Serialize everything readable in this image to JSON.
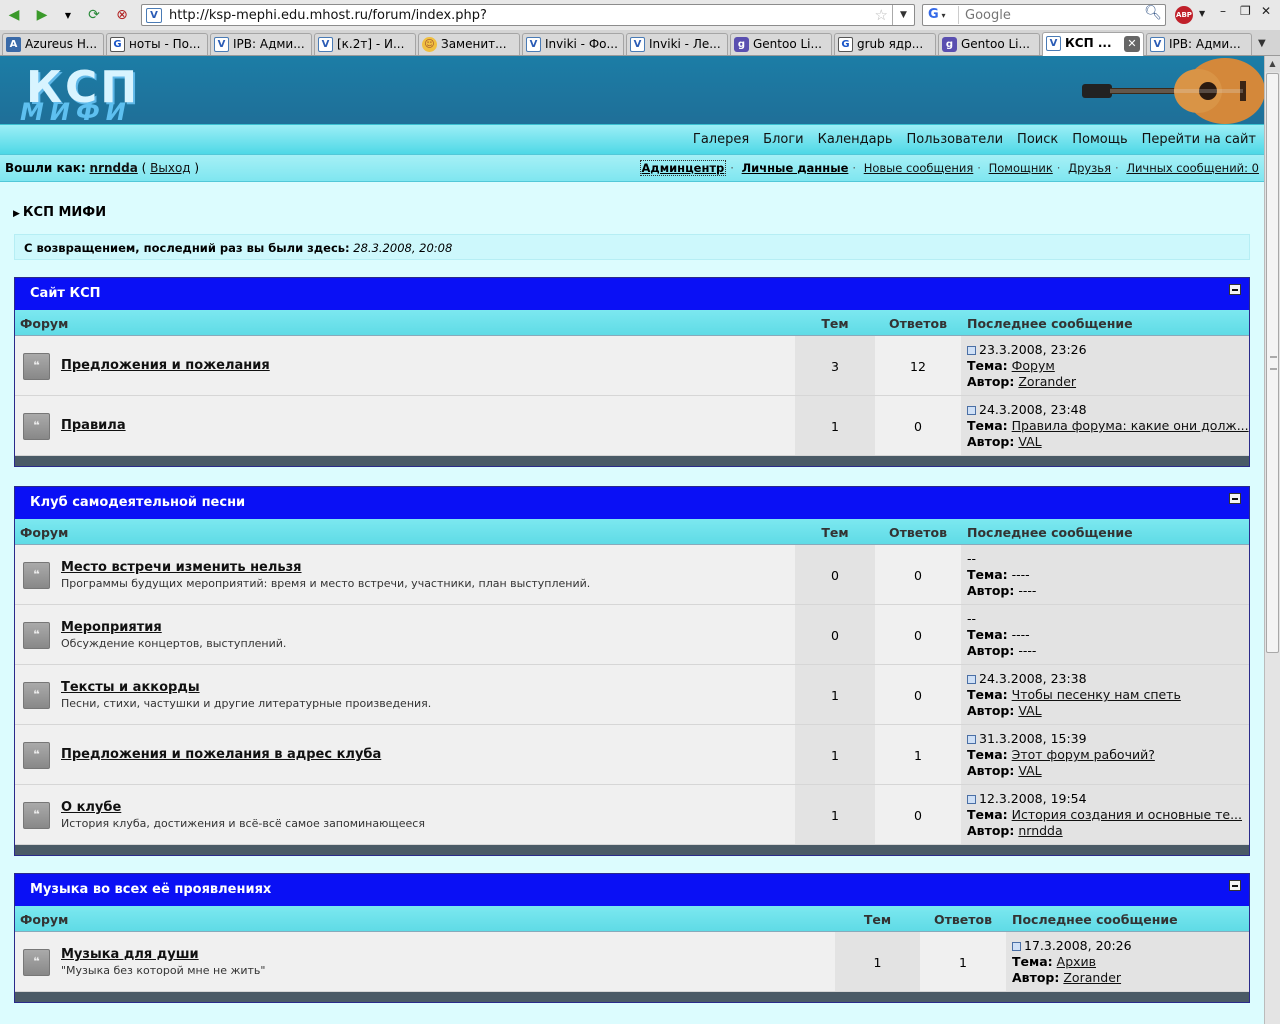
{
  "browser": {
    "url": "http://ksp-mephi.edu.mhost.ru/forum/index.php?",
    "search_placeholder": "Google",
    "search_engine": "G",
    "abp_label": "ABP",
    "tabs": [
      {
        "label": "Azureus H...",
        "icon": "az"
      },
      {
        "label": "ноты - По...",
        "icon": "g"
      },
      {
        "label": "IPB: Адми...",
        "icon": "ipb"
      },
      {
        "label": "[к.2т] - И...",
        "icon": "ipb"
      },
      {
        "label": "Заменит...",
        "icon": "face"
      },
      {
        "label": "Inviki - Фо...",
        "icon": "ipb"
      },
      {
        "label": "Inviki - Ле...",
        "icon": "ipb"
      },
      {
        "label": "Gentoo Li...",
        "icon": "gentoo"
      },
      {
        "label": "grub ядр...",
        "icon": "g"
      },
      {
        "label": "Gentoo Li...",
        "icon": "gentoo"
      },
      {
        "label": "КСП ...",
        "icon": "ipb",
        "active": true
      },
      {
        "label": "IPB: Адми...",
        "icon": "ipb"
      }
    ]
  },
  "header": {
    "logo_top": "КСП",
    "logo_bottom": "МИФИ"
  },
  "menu": [
    "Галерея",
    "Блоги",
    "Календарь",
    "Пользователи",
    "Поиск",
    "Помощь",
    "Перейти на сайт"
  ],
  "userbar": {
    "logged_in_label": "Вошли как:",
    "username": "nrndda",
    "logout": "Выход",
    "links": {
      "admin": "Админцентр",
      "personal": "Личные данные",
      "new_posts": "Новые сообщения",
      "assistant": "Помощник",
      "friends": "Друзья",
      "messages": "Личных сообщений: 0"
    }
  },
  "breadcrumb": "КСП МИФИ",
  "welcome": {
    "label": "С возвращением, последний раз вы были здесь:",
    "date": "28.3.2008, 20:08"
  },
  "columns": {
    "forum": "Форум",
    "topics": "Тем",
    "replies": "Ответов",
    "last": "Последнее сообщение"
  },
  "last_labels": {
    "topic": "Тема:",
    "author": "Автор:"
  },
  "categories": [
    {
      "title": "Сайт КСП",
      "forums": [
        {
          "title": "Предложения и пожелания",
          "desc": "",
          "topics": "3",
          "replies": "12",
          "last_date": "23.3.2008, 23:26",
          "last_topic": "Форум",
          "last_author": "Zorander"
        },
        {
          "title": "Правила",
          "desc": "",
          "topics": "1",
          "replies": "0",
          "last_date": "24.3.2008, 23:48",
          "last_topic": "Правила форума: какие они долж...",
          "last_author": "VAL"
        }
      ]
    },
    {
      "title": "Клуб самодеятельной песни",
      "forums": [
        {
          "title": "Место встречи изменить нельзя",
          "desc": "Программы будущих мероприятий: время и место встречи, участники, план выступлений.",
          "topics": "0",
          "replies": "0",
          "last_date": "--",
          "last_topic": "----",
          "last_author": "----"
        },
        {
          "title": "Мероприятия",
          "desc": "Обсуждение концертов, выступлений.",
          "topics": "0",
          "replies": "0",
          "last_date": "--",
          "last_topic": "----",
          "last_author": "----"
        },
        {
          "title": "Тексты и аккорды",
          "desc": "Песни, стихи, частушки и другие литературные произведения.",
          "topics": "1",
          "replies": "0",
          "last_date": "24.3.2008, 23:38",
          "last_topic": "Чтобы песенку нам спеть",
          "last_author": "VAL"
        },
        {
          "title": "Предложения и пожелания в адрес клуба",
          "desc": "",
          "topics": "1",
          "replies": "1",
          "last_date": "31.3.2008, 15:39",
          "last_topic": "Этот форум рабочий?",
          "last_author": "VAL"
        },
        {
          "title": "О клубе",
          "desc": "История клуба, достижения и всё-всё самое запоминающееся",
          "topics": "1",
          "replies": "0",
          "last_date": "12.3.2008, 19:54",
          "last_topic": "История создания и основные те...",
          "last_author": "nrndda"
        }
      ]
    },
    {
      "title": "Музыка во всех её проявлениях",
      "forums": [
        {
          "title": "Музыка для души",
          "desc": "\"Музыка без которой мне не жить\"",
          "topics": "1",
          "replies": "1",
          "last_date": "17.3.2008, 20:26",
          "last_topic": "Архив",
          "last_author": "Zorander"
        }
      ]
    }
  ]
}
